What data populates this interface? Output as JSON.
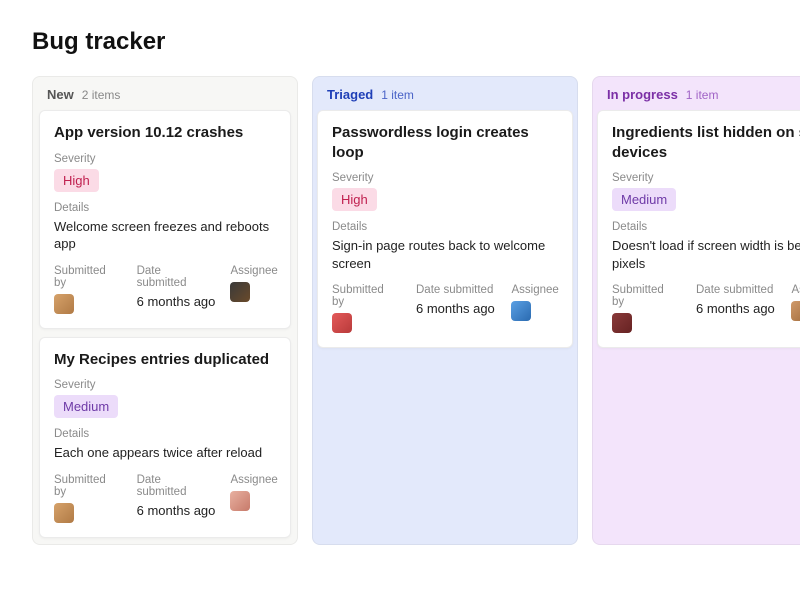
{
  "title": "Bug tracker",
  "columns": [
    {
      "id": "new",
      "title": "New",
      "count_label": "2 items",
      "cards": [
        {
          "title": "App version 10.12 crashes",
          "severity_label": "Severity",
          "severity": "High",
          "severity_class": "sev-high",
          "details_label": "Details",
          "details": "Welcome screen freezes and reboots app",
          "submitted_by_label": "Submitted by",
          "submitted_by_avatar": "av-a",
          "date_submitted_label": "Date submitted",
          "date_submitted": "6 months ago",
          "assignee_label": "Assignee",
          "assignee_avatar": "av-b"
        },
        {
          "title": "My Recipes entries duplicated",
          "severity_label": "Severity",
          "severity": "Medium",
          "severity_class": "sev-medium",
          "details_label": "Details",
          "details": "Each one appears twice after reload",
          "submitted_by_label": "Submitted by",
          "submitted_by_avatar": "av-a",
          "date_submitted_label": "Date submitted",
          "date_submitted": "6 months ago",
          "assignee_label": "Assignee",
          "assignee_avatar": "av-c"
        }
      ]
    },
    {
      "id": "triaged",
      "title": "Triaged",
      "count_label": "1 item",
      "cards": [
        {
          "title": "Passwordless login creates loop",
          "severity_label": "Severity",
          "severity": "High",
          "severity_class": "sev-high",
          "details_label": "Details",
          "details": "Sign-in page routes back to welcome screen",
          "submitted_by_label": "Submitted by",
          "submitted_by_avatar": "av-d",
          "date_submitted_label": "Date submitted",
          "date_submitted": "6 months ago",
          "assignee_label": "Assignee",
          "assignee_avatar": "av-e"
        }
      ]
    },
    {
      "id": "inprogress",
      "title": "In progress",
      "count_label": "1 item",
      "cards": [
        {
          "title": "Ingredients list hidden on small devices",
          "severity_label": "Severity",
          "severity": "Medium",
          "severity_class": "sev-medium",
          "details_label": "Details",
          "details": "Doesn't load if screen width is below pixels",
          "submitted_by_label": "Submitted by",
          "submitted_by_avatar": "av-f",
          "date_submitted_label": "Date submitted",
          "date_submitted": "6 months ago",
          "assignee_label": "Assignee",
          "assignee_avatar": "av-g"
        }
      ]
    }
  ]
}
